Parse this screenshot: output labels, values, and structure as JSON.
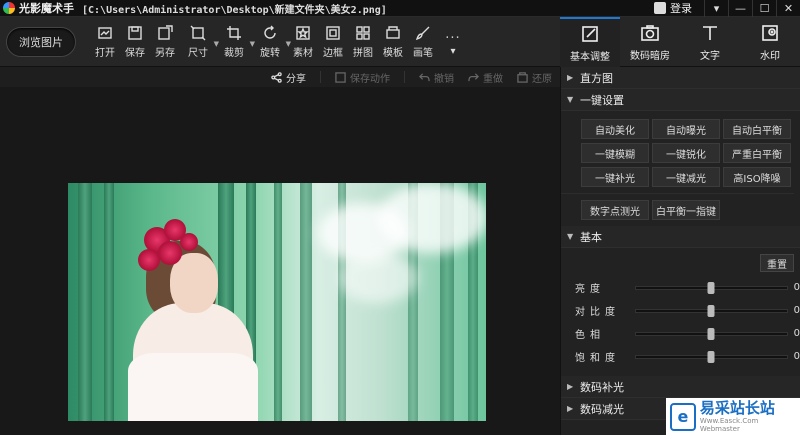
{
  "titlebar": {
    "app_name": "光影魔术手",
    "file_path": "[C:\\Users\\Administrator\\Desktop\\新建文件夹\\美女2.png]",
    "login_label": "登录",
    "window_buttons": [
      "▾",
      "—",
      "☐",
      "✕"
    ]
  },
  "toolbar": {
    "browse_label": "浏览图片",
    "tools": [
      {
        "label": "打开",
        "icon": "open-icon"
      },
      {
        "label": "保存",
        "icon": "save-icon"
      },
      {
        "label": "另存",
        "icon": "save-as-icon"
      },
      {
        "label": "尺寸",
        "icon": "resize-icon",
        "dropdown": true
      },
      {
        "label": "裁剪",
        "icon": "crop-icon",
        "dropdown": true
      },
      {
        "label": "旋转",
        "icon": "rotate-icon",
        "dropdown": true
      },
      {
        "label": "素材",
        "icon": "material-icon"
      },
      {
        "label": "边框",
        "icon": "border-icon"
      },
      {
        "label": "拼图",
        "icon": "collage-icon"
      },
      {
        "label": "模板",
        "icon": "template-icon"
      },
      {
        "label": "画笔",
        "icon": "brush-icon"
      }
    ],
    "more_label": "..."
  },
  "right_tabs": [
    {
      "label": "基本调整",
      "icon": "basic-adjust-icon",
      "active": true
    },
    {
      "label": "数码暗房",
      "icon": "darkroom-icon",
      "active": false
    },
    {
      "label": "文字",
      "icon": "text-icon",
      "active": false
    },
    {
      "label": "水印",
      "icon": "watermark-icon",
      "active": false
    }
  ],
  "subbar": {
    "share": "分享",
    "save_action": "保存动作",
    "undo": "撤销",
    "redo": "重做",
    "restore": "还原"
  },
  "panel": {
    "histogram": "直方图",
    "one_click": "一键设置",
    "one_click_buttons": [
      "自动美化",
      "自动曝光",
      "自动白平衡",
      "一键模糊",
      "一键锐化",
      "严重白平衡",
      "一键补光",
      "一键减光",
      "高ISO降噪"
    ],
    "extra_buttons": [
      "数字点测光",
      "白平衡一指键"
    ],
    "basic": "基本",
    "reset": "重置",
    "sliders": [
      {
        "label": "亮度",
        "value": "0",
        "level": 0.5
      },
      {
        "label": "对比度",
        "value": "0",
        "level": 0.5
      },
      {
        "label": "色相",
        "value": "0",
        "level": 0.5
      },
      {
        "label": "饱和度",
        "value": "0",
        "level": 0.5
      }
    ],
    "digital_fill": "数码补光",
    "digital_reduce": "数码减光"
  },
  "watermark": {
    "title": "易采站长站",
    "sub": "Www.Easck.Com Webmaster"
  },
  "colors": {
    "accent": "#1f78d1",
    "background": "#1a1a1a"
  }
}
